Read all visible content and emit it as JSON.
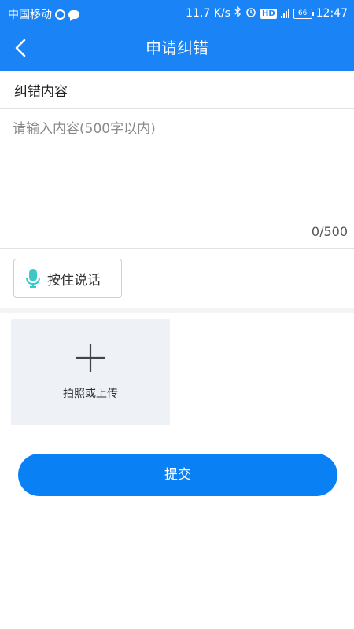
{
  "status_bar": {
    "carrier": "中国移动",
    "speed": "11.7 K/s",
    "network": "4G",
    "battery": "66",
    "time": "12:47"
  },
  "header": {
    "title": "申请纠错"
  },
  "form": {
    "section_title": "纠错内容",
    "content_placeholder": "请输入内容(500字以内)",
    "char_count": "0/500",
    "voice_label": "按住说话",
    "upload_label": "拍照或上传",
    "submit_label": "提交"
  },
  "colors": {
    "primary": "#1a84f6",
    "submit": "#0a80f5",
    "mic": "#3cc8c8"
  }
}
